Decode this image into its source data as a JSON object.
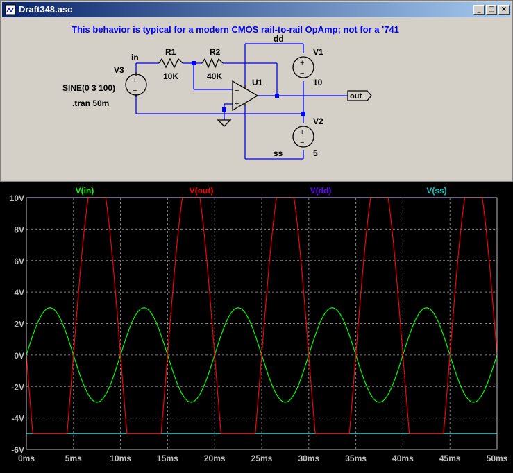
{
  "window": {
    "title": "Draft348.asc",
    "buttons": {
      "minimize": "_",
      "maximize": "□",
      "close": "×"
    }
  },
  "schematic": {
    "comment": "This behavior is typical for a modern CMOS rail-to-rail OpAmp; not for a '741",
    "labels": {
      "net_in": "in",
      "net_dd": "dd",
      "net_ss": "ss",
      "net_out": "out",
      "r1_name": "R1",
      "r1_value": "10K",
      "r2_name": "R2",
      "r2_value": "40K",
      "u1_name": "U1",
      "v1_name": "V1",
      "v1_value": "10",
      "v2_name": "V2",
      "v2_value": "5",
      "v3_name": "V3",
      "v3_value": "SINE(0 3 100)",
      "directive": ".tran 50m"
    },
    "colors": {
      "wire": "#0000ff",
      "comment": "#0000ff",
      "component": "#000000"
    }
  },
  "plot": {
    "traces": [
      {
        "name": "V(in)",
        "color": "#00ff00"
      },
      {
        "name": "V(out)",
        "color": "#ff0000"
      },
      {
        "name": "V(dd)",
        "color": "#6600ff"
      },
      {
        "name": "V(ss)",
        "color": "#00cccc"
      }
    ],
    "y_ticks": [
      "10V",
      "8V",
      "6V",
      "4V",
      "2V",
      "0V",
      "-2V",
      "-4V",
      "-6V"
    ],
    "x_ticks": [
      "0ms",
      "5ms",
      "10ms",
      "15ms",
      "20ms",
      "25ms",
      "30ms",
      "35ms",
      "40ms",
      "45ms",
      "50ms"
    ],
    "colors": {
      "background": "#000000",
      "grid": "#808080",
      "axis_text": "#c0c0c0"
    }
  },
  "chart_data": {
    "type": "line",
    "xlabel": "",
    "ylabel": "",
    "xlim": [
      0,
      50
    ],
    "ylim": [
      -6,
      10
    ],
    "x_unit": "ms",
    "y_unit": "V",
    "grid": true,
    "series": [
      {
        "name": "V(in)",
        "kind": "sine",
        "amplitude": 3,
        "offset": 0,
        "frequency_hz": 100
      },
      {
        "name": "V(out)",
        "kind": "sine-clipped",
        "amplitude": 12,
        "offset": 0,
        "frequency_hz": 100,
        "phase_inverted": true,
        "clip": [
          -5,
          10
        ]
      },
      {
        "name": "V(dd)",
        "kind": "constant",
        "value": 10
      },
      {
        "name": "V(ss)",
        "kind": "constant",
        "value": -5
      }
    ]
  }
}
